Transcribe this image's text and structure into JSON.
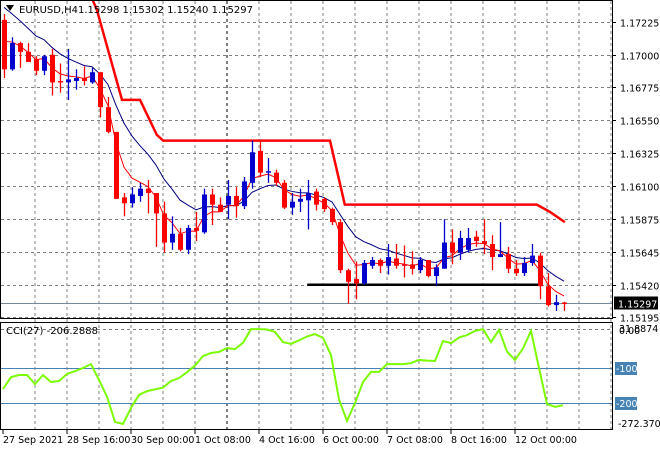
{
  "chart_data": [
    {
      "type": "candlestick",
      "title": "EURUSD,H4",
      "ohlc_readout": "1.15298 1.15302 1.15240 1.15297",
      "ylabel": "",
      "ylim": [
        1.1515,
        1.1738
      ],
      "y_ticks": [
        "1.17225",
        "1.17000",
        "1.16775",
        "1.16550",
        "1.16325",
        "1.16100",
        "1.15875",
        "1.15645",
        "1.15420",
        "1.15195"
      ],
      "current_price": "1.15297",
      "x_ticks": [
        "27 Sep 2021",
        "28 Sep 16:00",
        "30 Sep 00:00",
        "1 Oct 08:00",
        "4 Oct 16:00",
        "6 Oct 00:00",
        "7 Oct 08:00",
        "8 Oct 16:00",
        "12 Oct 00:00"
      ],
      "x_tick_bar_index": [
        0,
        8,
        16,
        24,
        32,
        40,
        48,
        56,
        64
      ],
      "day_separator_bar_index": [
        28,
        58
      ],
      "candles": [
        [
          1.1724,
          1.1728,
          1.1684,
          1.169
        ],
        [
          1.169,
          1.1712,
          1.1689,
          1.1708
        ],
        [
          1.1708,
          1.1709,
          1.1691,
          1.1702
        ],
        [
          1.1702,
          1.1708,
          1.1695,
          1.1695
        ],
        [
          1.1697,
          1.1699,
          1.1686,
          1.1689
        ],
        [
          1.1689,
          1.17,
          1.1686,
          1.1699
        ],
        [
          1.17,
          1.1704,
          1.1672,
          1.1681
        ],
        [
          1.1682,
          1.1694,
          1.1674,
          1.1681
        ],
        [
          1.1681,
          1.1704,
          1.1669,
          1.1683
        ],
        [
          1.1682,
          1.169,
          1.1676,
          1.1684
        ],
        [
          1.1684,
          1.1692,
          1.1679,
          1.1682
        ],
        [
          1.1681,
          1.1691,
          1.168,
          1.1688
        ],
        [
          1.1688,
          1.1688,
          1.1657,
          1.1664
        ],
        [
          1.1664,
          1.1671,
          1.1646,
          1.1647
        ],
        [
          1.1647,
          1.1647,
          1.1601,
          1.1601
        ],
        [
          1.1602,
          1.1605,
          1.1589,
          1.1598
        ],
        [
          1.1598,
          1.1609,
          1.1595,
          1.1604
        ],
        [
          1.1603,
          1.1612,
          1.1599,
          1.1608
        ],
        [
          1.1608,
          1.1614,
          1.1591,
          1.1605
        ],
        [
          1.1605,
          1.1605,
          1.1568,
          1.1591
        ],
        [
          1.1591,
          1.1599,
          1.1564,
          1.1571
        ],
        [
          1.1571,
          1.1589,
          1.1566,
          1.1577
        ],
        [
          1.1577,
          1.1581,
          1.1565,
          1.1566
        ],
        [
          1.1566,
          1.1583,
          1.1563,
          1.1581
        ],
        [
          1.1581,
          1.1592,
          1.1572,
          1.1579
        ],
        [
          1.1578,
          1.1608,
          1.1577,
          1.1604
        ],
        [
          1.1604,
          1.1608,
          1.1583,
          1.1597
        ],
        [
          1.1597,
          1.1602,
          1.1592,
          1.1592
        ],
        [
          1.1597,
          1.1614,
          1.1587,
          1.1603
        ],
        [
          1.1603,
          1.1609,
          1.1588,
          1.1596
        ],
        [
          1.1596,
          1.1616,
          1.1594,
          1.1613
        ],
        [
          1.1612,
          1.1641,
          1.1608,
          1.1633
        ],
        [
          1.1634,
          1.1641,
          1.1616,
          1.1619
        ],
        [
          1.1619,
          1.1629,
          1.1612,
          1.162
        ],
        [
          1.1619,
          1.1621,
          1.161,
          1.1612
        ],
        [
          1.1612,
          1.1614,
          1.1594,
          1.1595
        ],
        [
          1.1595,
          1.1605,
          1.159,
          1.1599
        ],
        [
          1.1599,
          1.1608,
          1.1592,
          1.1601
        ],
        [
          1.16,
          1.1614,
          1.158,
          1.1605
        ],
        [
          1.1606,
          1.1608,
          1.1593,
          1.1597
        ],
        [
          1.1601,
          1.1602,
          1.1592,
          1.1594
        ],
        [
          1.1594,
          1.1595,
          1.1583,
          1.1585
        ],
        [
          1.1585,
          1.1587,
          1.155,
          1.1552
        ],
        [
          1.1552,
          1.1553,
          1.1529,
          1.1544
        ],
        [
          1.1546,
          1.1558,
          1.1532,
          1.1543
        ],
        [
          1.1543,
          1.1559,
          1.1542,
          1.1557
        ],
        [
          1.1555,
          1.1561,
          1.1553,
          1.1559
        ],
        [
          1.1559,
          1.156,
          1.155,
          1.1555
        ],
        [
          1.1555,
          1.157,
          1.1549,
          1.1561
        ],
        [
          1.156,
          1.157,
          1.1553,
          1.1555
        ],
        [
          1.1556,
          1.1569,
          1.1547,
          1.1555
        ],
        [
          1.1556,
          1.1565,
          1.1549,
          1.1553
        ],
        [
          1.1552,
          1.1561,
          1.155,
          1.1559
        ],
        [
          1.1559,
          1.1559,
          1.1547,
          1.1548
        ],
        [
          1.1548,
          1.1556,
          1.1541,
          1.1554
        ],
        [
          1.1553,
          1.1587,
          1.1553,
          1.1571
        ],
        [
          1.1571,
          1.158,
          1.1556,
          1.1564
        ],
        [
          1.1564,
          1.1579,
          1.1559,
          1.1574
        ],
        [
          1.1566,
          1.1581,
          1.1564,
          1.1574
        ],
        [
          1.1575,
          1.1579,
          1.1568,
          1.1572
        ],
        [
          1.1572,
          1.1587,
          1.1563,
          1.157
        ],
        [
          1.157,
          1.1576,
          1.1552,
          1.1561
        ],
        [
          1.1561,
          1.1585,
          1.1561,
          1.1563
        ],
        [
          1.1563,
          1.1568,
          1.155,
          1.1553
        ],
        [
          1.1553,
          1.1559,
          1.1548,
          1.155
        ],
        [
          1.155,
          1.1561,
          1.1548,
          1.1557
        ],
        [
          1.1557,
          1.157,
          1.1555,
          1.1562
        ],
        [
          1.1562,
          1.1564,
          1.1532,
          1.1541
        ],
        [
          1.1541,
          1.155,
          1.1527,
          1.1528
        ],
        [
          1.1528,
          1.1535,
          1.1524,
          1.153
        ],
        [
          1.15298,
          1.15302,
          1.1524,
          1.15297
        ]
      ],
      "step_line": [
        [
          10.5,
          1.1745
        ],
        [
          11.6,
          1.1731
        ],
        [
          14.75,
          1.1669
        ],
        [
          17,
          1.1669
        ],
        [
          19.1,
          1.1645
        ],
        [
          19.9,
          1.1641
        ],
        [
          40.75,
          1.1641
        ],
        [
          42.6,
          1.1597
        ],
        [
          66.6,
          1.1597
        ],
        [
          68.25,
          1.1592
        ],
        [
          70.1,
          1.1585
        ]
      ],
      "support_line": {
        "price": 1.1542,
        "from_bar": 37.9,
        "to_bar": 67
      },
      "colors": {
        "bull": "#0000CD",
        "bear": "#FF0000",
        "slow_ma": "#000080",
        "fast_ma": "#FF0000",
        "step": "#FF0000",
        "support": "#000000"
      }
    },
    {
      "type": "line",
      "title": "CCI(27) -206.2888",
      "ylim": [
        -272.3705,
        31.8874
      ],
      "y_ticks": [
        "31.8874",
        "0.00",
        "-100",
        "-200",
        "-272.3705"
      ],
      "levels": [
        -100,
        -200
      ],
      "values": [
        -160,
        -126,
        -120,
        -120,
        -146,
        -120,
        -140,
        -137,
        -117,
        -109,
        -100,
        -89,
        -134,
        -182,
        -254,
        -260,
        -214,
        -177,
        -166,
        -161,
        -156,
        -137,
        -129,
        -112,
        -93,
        -66,
        -57,
        -54,
        -43,
        -46,
        -28,
        11,
        11,
        10,
        3,
        -26,
        -31,
        -21,
        -10,
        -3,
        -14,
        -63,
        -190,
        -251,
        -200,
        -140,
        -111,
        -111,
        -89,
        -89,
        -89,
        -86,
        -77,
        -79,
        -80,
        -23,
        -29,
        -13,
        -6,
        6,
        11,
        -26,
        9,
        -53,
        -77,
        -44,
        6,
        -100,
        -203,
        -211,
        -206.2888
      ],
      "colors": {
        "line": "#7CFC00",
        "level": "#4682B4"
      }
    }
  ]
}
